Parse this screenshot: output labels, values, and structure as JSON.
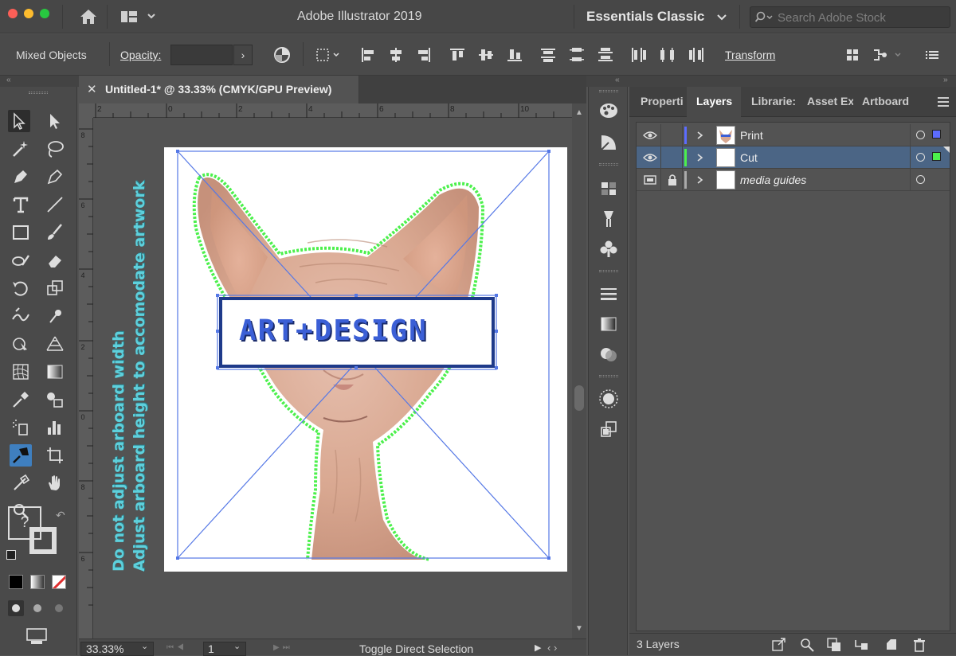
{
  "window": {
    "title": "Adobe Illustrator 2019"
  },
  "workspace": {
    "label": "Essentials Classic"
  },
  "stock_search": {
    "placeholder": "Search Adobe Stock"
  },
  "control_bar": {
    "selection_type": "Mixed Objects",
    "opacity_label": "Opacity:",
    "opacity_value": "",
    "transform_label": "Transform"
  },
  "document": {
    "tab_title": "Untitled-1* @ 33.33% (CMYK/GPU Preview)",
    "close_glyph": "✕"
  },
  "rulers": {
    "horizontal": [
      "2",
      "0",
      "2",
      "4",
      "6",
      "8",
      "10"
    ],
    "vertical": [
      "8",
      "6",
      "4",
      "2",
      "0",
      "8",
      "6"
    ]
  },
  "artwork": {
    "guide_line_1": "Do not adjust arboard width",
    "guide_line_2": "Adjust arboard height to accomodate artwork",
    "logo_text": "ART+DESIGN",
    "colors": {
      "cut_line": "#4cf04c",
      "selection": "#5578e6",
      "guide_text": "#5ed0dc"
    }
  },
  "status": {
    "zoom": "33.33%",
    "page": "1",
    "tool_hint": "Toggle Direct Selection"
  },
  "panels": {
    "tabs": [
      "Properties",
      "Layers",
      "Libraries",
      "Asset Export",
      "Artboards"
    ],
    "tab_display": [
      "Properti",
      "Layers",
      "Librarie:",
      "Asset Ex",
      "Artboard"
    ],
    "active_tab": "Layers",
    "layers": [
      {
        "name": "Print",
        "color": "#5c6cff",
        "visible": true,
        "locked": false,
        "selected": false,
        "italic": false
      },
      {
        "name": "Cut",
        "color": "#4cf04c",
        "visible": true,
        "locked": false,
        "selected": true,
        "italic": false
      },
      {
        "name": "media guides",
        "color": "#aaaaaa",
        "visible": true,
        "locked": true,
        "selected": false,
        "italic": true
      }
    ],
    "layer_count": "3 Layers"
  }
}
